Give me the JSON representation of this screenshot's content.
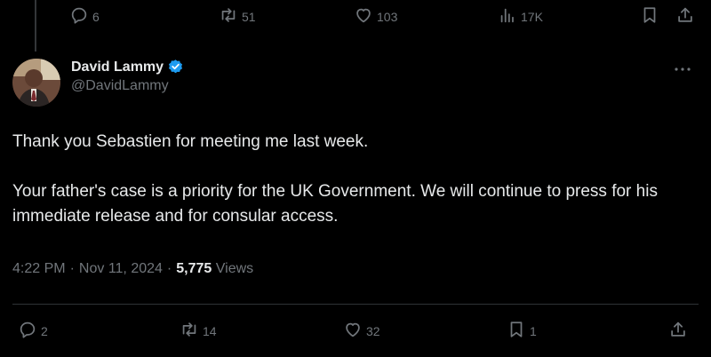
{
  "parent_actions": {
    "replies": "6",
    "reposts": "51",
    "likes": "103",
    "views": "17K"
  },
  "author": {
    "name": "David Lammy",
    "handle": "@DavidLammy",
    "verified": true,
    "badge_color": "#1d9bf0"
  },
  "tweet": {
    "paragraph_1": "Thank you Sebastien for meeting me last week.",
    "paragraph_2": "Your father's case is a priority for the UK Government. We will continue to press for his immediate release and for consular access."
  },
  "meta": {
    "time": "4:22 PM",
    "sep1": "·",
    "date": "Nov 11, 2024",
    "sep2": "·",
    "views_count": "5,775",
    "views_label": "Views"
  },
  "actions": {
    "replies": "2",
    "reposts": "14",
    "likes": "32",
    "bookmarks": "1"
  },
  "icons": {
    "reply": "reply-icon",
    "repost": "repost-icon",
    "like": "heart-icon",
    "views": "views-icon",
    "bookmark": "bookmark-icon",
    "share": "share-icon",
    "more": "more-icon",
    "verified": "verified-badge-icon"
  },
  "colors": {
    "background": "#000000",
    "text": "#e7e9ea",
    "muted": "#71767b",
    "divider": "#2f3336"
  }
}
